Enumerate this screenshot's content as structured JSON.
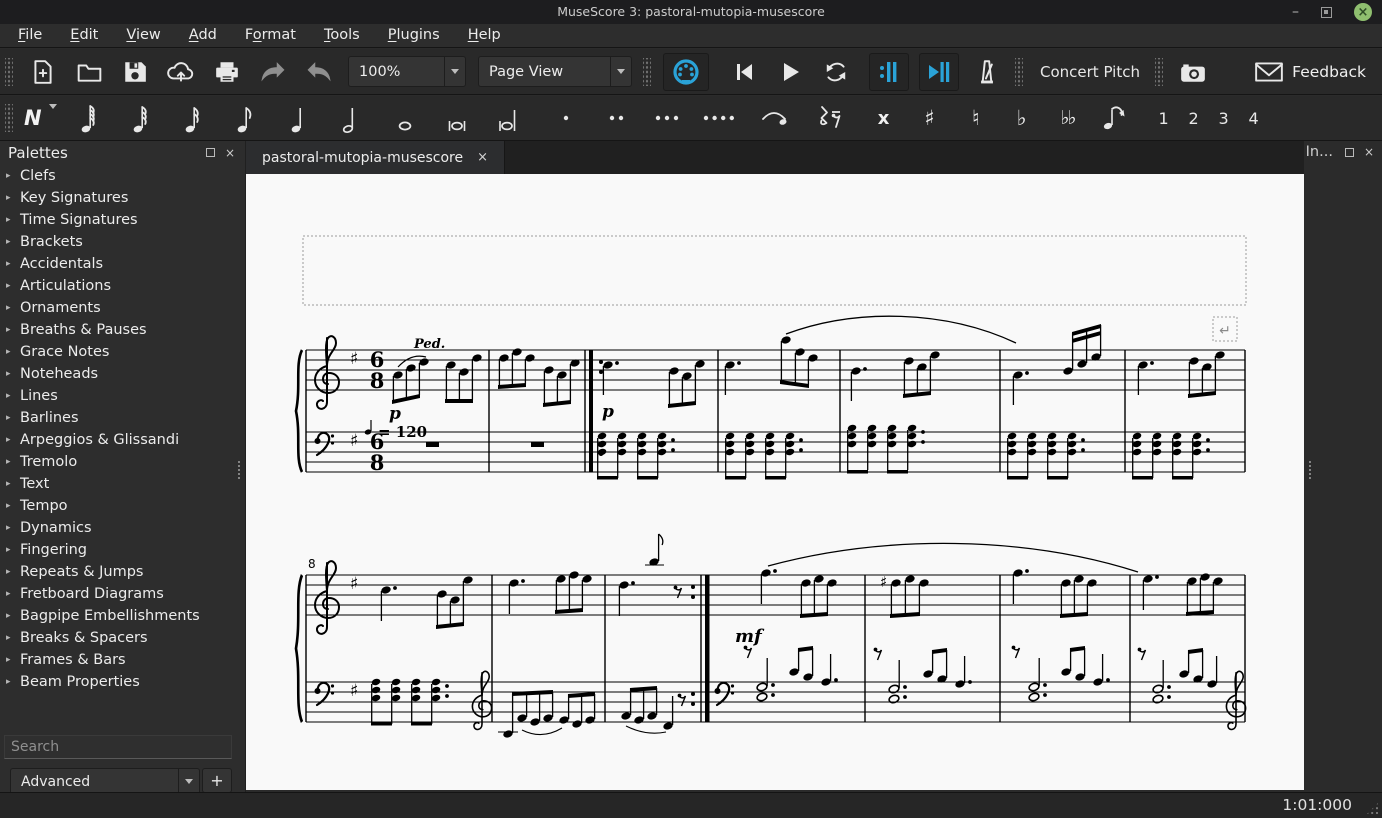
{
  "window": {
    "title": "MuseScore 3: pastoral-mutopia-musescore",
    "minimize_glyph": "–"
  },
  "ui": {
    "close_glyph": "×",
    "expand_arrow": "▸"
  },
  "menu": {
    "items": [
      {
        "label": "File",
        "m": 0
      },
      {
        "label": "Edit",
        "m": 0
      },
      {
        "label": "View",
        "m": 0
      },
      {
        "label": "Add",
        "m": 0
      },
      {
        "label": "Format",
        "m": 1
      },
      {
        "label": "Tools",
        "m": 0
      },
      {
        "label": "Plugins",
        "m": 0
      },
      {
        "label": "Help",
        "m": 0
      }
    ]
  },
  "toolbar": {
    "zoom_value": "100%",
    "view_mode": "Page View",
    "concert_pitch_label": "Concert Pitch",
    "feedback_label": "Feedback"
  },
  "note_toolbar": {
    "input_label": "N",
    "double_sharp": "x",
    "sharp": "♯",
    "natural": "♮",
    "flat": "♭",
    "double_flat": "♭♭",
    "voices": [
      "1",
      "2",
      "3",
      "4"
    ]
  },
  "palettes": {
    "title": "Palettes",
    "items": [
      "Clefs",
      "Key Signatures",
      "Time Signatures",
      "Brackets",
      "Accidentals",
      "Articulations",
      "Ornaments",
      "Breaths & Pauses",
      "Grace Notes",
      "Noteheads",
      "Lines",
      "Barlines",
      "Arpeggios & Glissandi",
      "Tremolo",
      "Text",
      "Tempo",
      "Dynamics",
      "Fingering",
      "Repeats & Jumps",
      "Fretboard Diagrams",
      "Bagpipe Embellishments",
      "Breaks & Spacers",
      "Frames & Bars",
      "Beam Properties"
    ],
    "search_placeholder": "Search",
    "filter_value": "Advanced",
    "add_label": "+"
  },
  "tab": {
    "title": "pastoral-mutopia-musescore"
  },
  "inspector": {
    "title": "In..."
  },
  "score": {
    "tempo_text": "= 120",
    "ped": "Ped.",
    "p1": "p",
    "p2": "p",
    "mf": "mf",
    "measure_number": "8",
    "time_num": "6",
    "time_den": "8",
    "key_sharp": "♯",
    "layout_break_glyph": "↵"
  },
  "status": {
    "playback_time": "1:01:000"
  },
  "colors": {
    "accent_blue": "#2aa3d8",
    "close_green": "#8fbf6f",
    "page": "#f9f9f9"
  }
}
